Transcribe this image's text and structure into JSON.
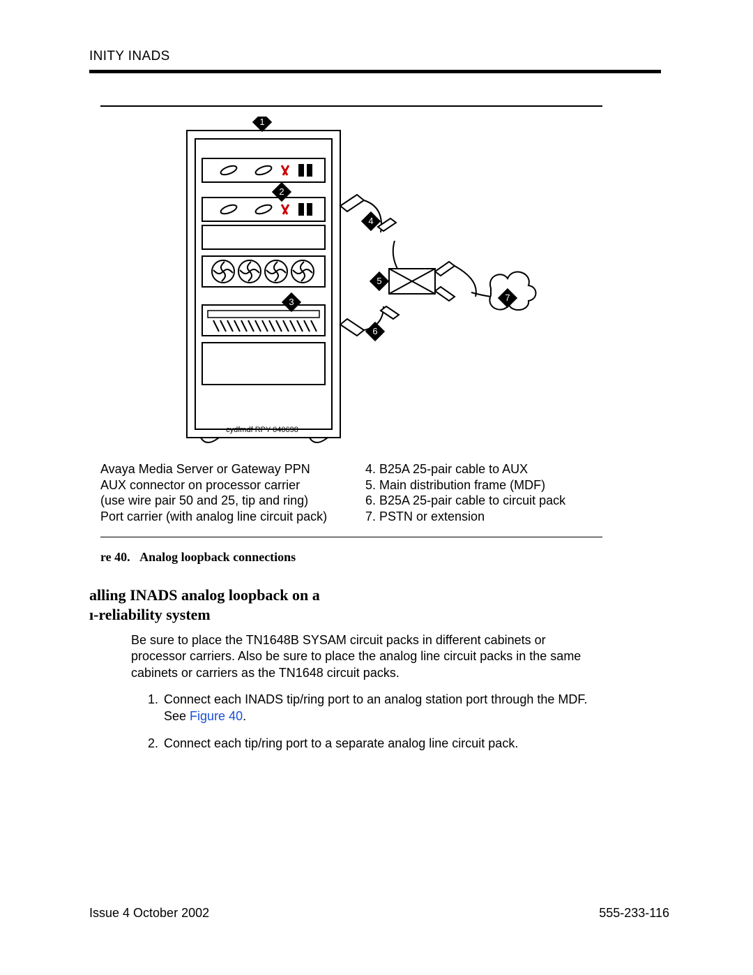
{
  "header": {
    "running_title": "INITY INADS"
  },
  "figure": {
    "drawing_id": "cydfmdf RPY 040698",
    "markers": [
      "1",
      "2",
      "3",
      "4",
      "5",
      "6",
      "7"
    ],
    "legend_left": [
      "Avaya Media Server or Gateway PPN",
      "AUX connector on processor carrier",
      "(use wire pair 50 and 25, tip and ring)",
      "Port carrier (with analog line circuit pack)"
    ],
    "legend_right": [
      "4. B25A 25-pair cable to AUX",
      "5. Main distribution frame (MDF)",
      "6. B25A 25-pair cable to circuit pack",
      "7. PSTN or extension"
    ]
  },
  "caption": {
    "label": "re 40.",
    "title": "Analog loopback connections"
  },
  "section": {
    "line1": "alling INADS analog loopback on a",
    "line2": "ı-reliability system"
  },
  "body": "Be sure to place the TN1648B SYSAM circuit packs in different cabinets or processor carriers. Also be sure to place the analog line circuit packs in the same cabinets or carriers as the TN1648 circuit packs.",
  "steps": [
    {
      "n": "1.",
      "text": "Connect each INADS tip/ring port to an analog station port through the MDF. See ",
      "link": "Figure 40",
      "after": "."
    },
    {
      "n": "2.",
      "text": "Connect each tip/ring port to a separate analog line circuit pack."
    }
  ],
  "footer": {
    "left": "Issue 4   October 2002",
    "right": "555-233-116"
  }
}
